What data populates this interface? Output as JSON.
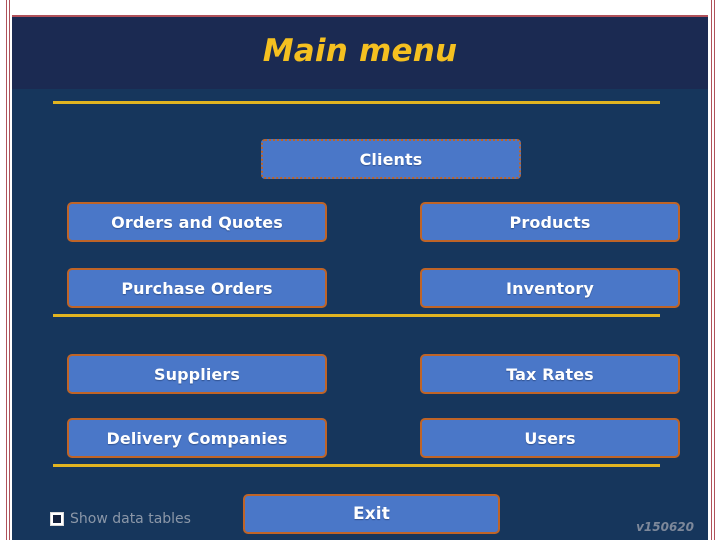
{
  "window": {
    "title": "Main menu",
    "version_label": "v150620"
  },
  "header": {
    "title": "Main menu"
  },
  "menu": {
    "featured": {
      "label": "Clients",
      "focused": true
    },
    "groups": [
      {
        "name": "operations",
        "rows": [
          {
            "left": "Orders and Quotes",
            "right": "Products"
          },
          {
            "left": "Purchase Orders",
            "right": "Inventory"
          }
        ]
      },
      {
        "name": "administration",
        "rows": [
          {
            "left": "Suppliers",
            "right": "Tax Rates"
          },
          {
            "left": "Delivery Companies",
            "right": "Users"
          }
        ]
      }
    ]
  },
  "footer": {
    "show_data_tables_label": "Show data tables",
    "show_data_tables_checked": false,
    "exit_label": "Exit"
  },
  "colors": {
    "panel_background": "#16365c",
    "header_background": "#1b2a52",
    "title_text": "#f5c020",
    "divider": "#e0b421",
    "button_fill": "#4a77c8",
    "button_border": "#bf6427",
    "button_text": "#ffffff",
    "frame_border": "#b0515a",
    "muted_text": "#8b97a8"
  }
}
